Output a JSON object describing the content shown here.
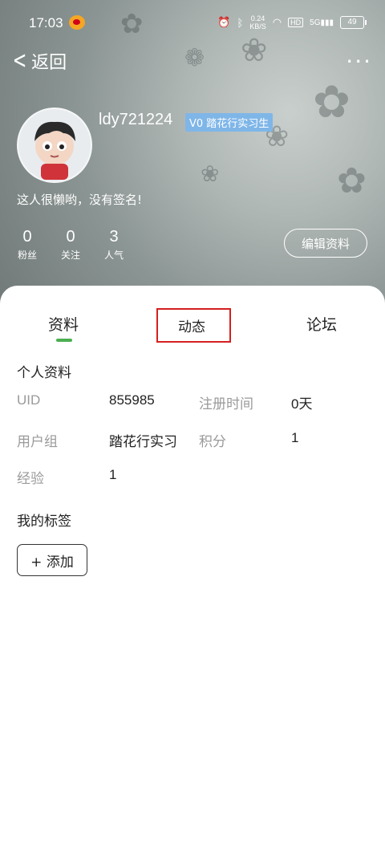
{
  "status_bar": {
    "time": "17:03",
    "network_speed": "0.24\nKB/S",
    "hd_label": "HD",
    "signal_label": "5G",
    "battery": "49"
  },
  "nav": {
    "back_label": "返回",
    "more_label": "···"
  },
  "profile": {
    "username": "ldy721224",
    "level_badge": "V0 踏花行实习生",
    "signature": "这人很懒哟，没有签名!",
    "stats": [
      {
        "value": "0",
        "label": "粉丝"
      },
      {
        "value": "0",
        "label": "关注"
      },
      {
        "value": "3",
        "label": "人气"
      }
    ],
    "edit_label": "编辑资料"
  },
  "tabs": [
    {
      "label": "资料",
      "active": true
    },
    {
      "label": "动态",
      "active": false
    },
    {
      "label": "论坛",
      "active": false
    }
  ],
  "personal_info": {
    "title": "个人资料",
    "fields": [
      {
        "label": "UID",
        "value": "855985"
      },
      {
        "label": "注册时间",
        "value": "0天"
      },
      {
        "label": "用户组",
        "value": "踏花行实习"
      },
      {
        "label": "积分",
        "value": "1"
      },
      {
        "label": "经验",
        "value": "1"
      }
    ]
  },
  "tags": {
    "title": "我的标签",
    "add_label": "+ 添加"
  },
  "colors": {
    "accent_green": "#4caf50",
    "badge_blue": "#7fb6e8",
    "highlight_red": "#d61f1f"
  }
}
